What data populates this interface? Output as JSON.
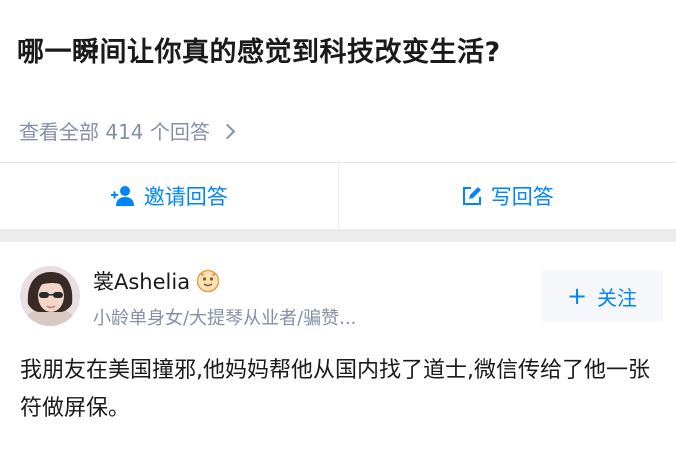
{
  "question": {
    "title": "哪一瞬间让你真的感觉到科技改变生活?",
    "view_all_label": "查看全部 414 个回答"
  },
  "actions": {
    "invite_label": "邀请回答",
    "write_label": "写回答"
  },
  "answer": {
    "author_name": "裳Ashelia",
    "author_bio": "小龄单身女/大提琴从业者/骗赞...",
    "follow_label": "关注",
    "follow_icon": "plus-icon",
    "text": "我朋友在美国撞邪,他妈妈帮他从国内找了道士,微信传给了他一张符做屏保。"
  },
  "colors": {
    "accent": "#0084ff",
    "meta_text": "#8590a6",
    "section_gap": "#ececec"
  }
}
